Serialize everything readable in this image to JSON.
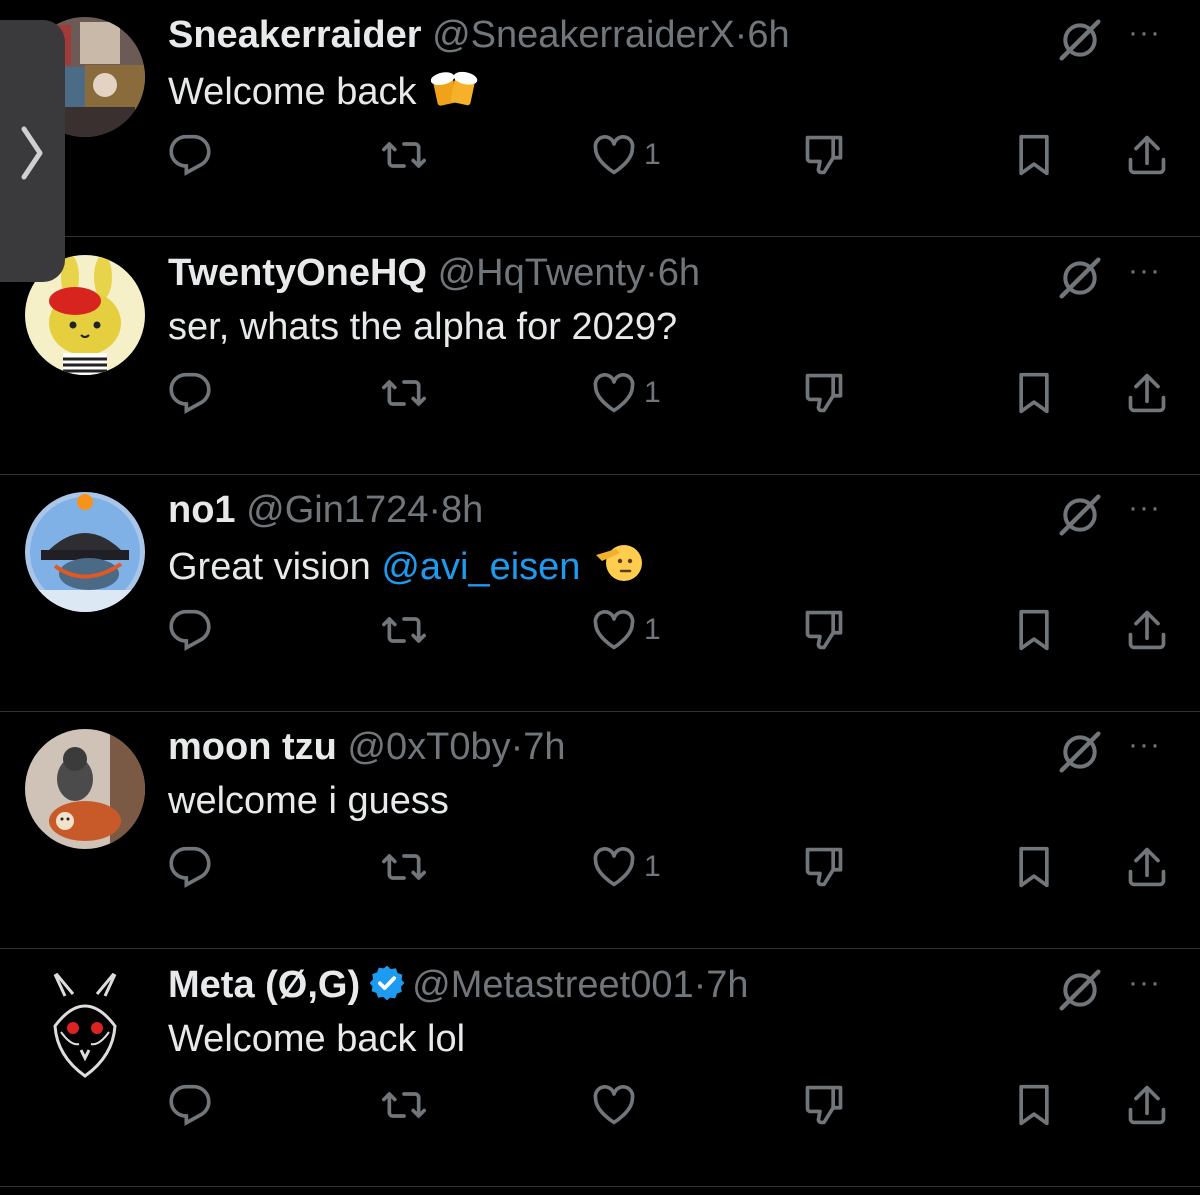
{
  "sidebar_tab": {
    "icon": "chevron-right-icon"
  },
  "posts": [
    {
      "name": "Sneakerraider",
      "handle": "@SneakerraiderX",
      "sep": "·",
      "time": "6h",
      "verified": false,
      "text_parts": [
        {
          "text": "Welcome back",
          "kind": "plain"
        }
      ],
      "emoji": "beer-mugs-emoji",
      "likes": "1",
      "avatar": "collage-avatar"
    },
    {
      "name": "TwentyOneHQ",
      "handle": "@HqTwenty",
      "sep": "·",
      "time": "6h",
      "verified": false,
      "text_parts": [
        {
          "text": "ser, whats the alpha for 2029?",
          "kind": "plain"
        }
      ],
      "emoji": "",
      "likes": "1",
      "avatar": "yellow-bunny-avatar"
    },
    {
      "name": "no1",
      "handle": "@Gin1724",
      "sep": "·",
      "time": "8h",
      "verified": false,
      "text_parts": [
        {
          "text": "Great vision ",
          "kind": "plain"
        },
        {
          "text": "@avi_eisen",
          "kind": "mention"
        }
      ],
      "emoji": "saluting-face-emoji",
      "likes": "1",
      "avatar": "bitcoin-cap-avatar"
    },
    {
      "name": "moon tzu",
      "handle": "@0xT0by",
      "sep": "·",
      "time": "7h",
      "verified": false,
      "text_parts": [
        {
          "text": "welcome i guess",
          "kind": "plain"
        }
      ],
      "emoji": "",
      "likes": "1",
      "avatar": "monkey-avatar"
    },
    {
      "name": "Meta (Ø,G)",
      "handle": "@Metastreet001",
      "sep": "·",
      "time": "7h",
      "verified": true,
      "text_parts": [
        {
          "text": "Welcome back lol",
          "kind": "plain"
        }
      ],
      "emoji": "",
      "likes": "",
      "avatar": "rabbit-skull-avatar"
    }
  ],
  "actions": {
    "reply": "reply-icon",
    "repost": "repost-icon",
    "like": "heart-icon",
    "downvote": "downvote-icon",
    "bookmark": "bookmark-icon",
    "share": "share-icon",
    "grok": "grok-icon",
    "more": "···"
  },
  "colors": {
    "background": "#000000",
    "text": "#e7e9ea",
    "muted": "#71767b",
    "mention": "#1d9bf0",
    "separator": "#2f3336",
    "verified": "#1d9bf0"
  }
}
